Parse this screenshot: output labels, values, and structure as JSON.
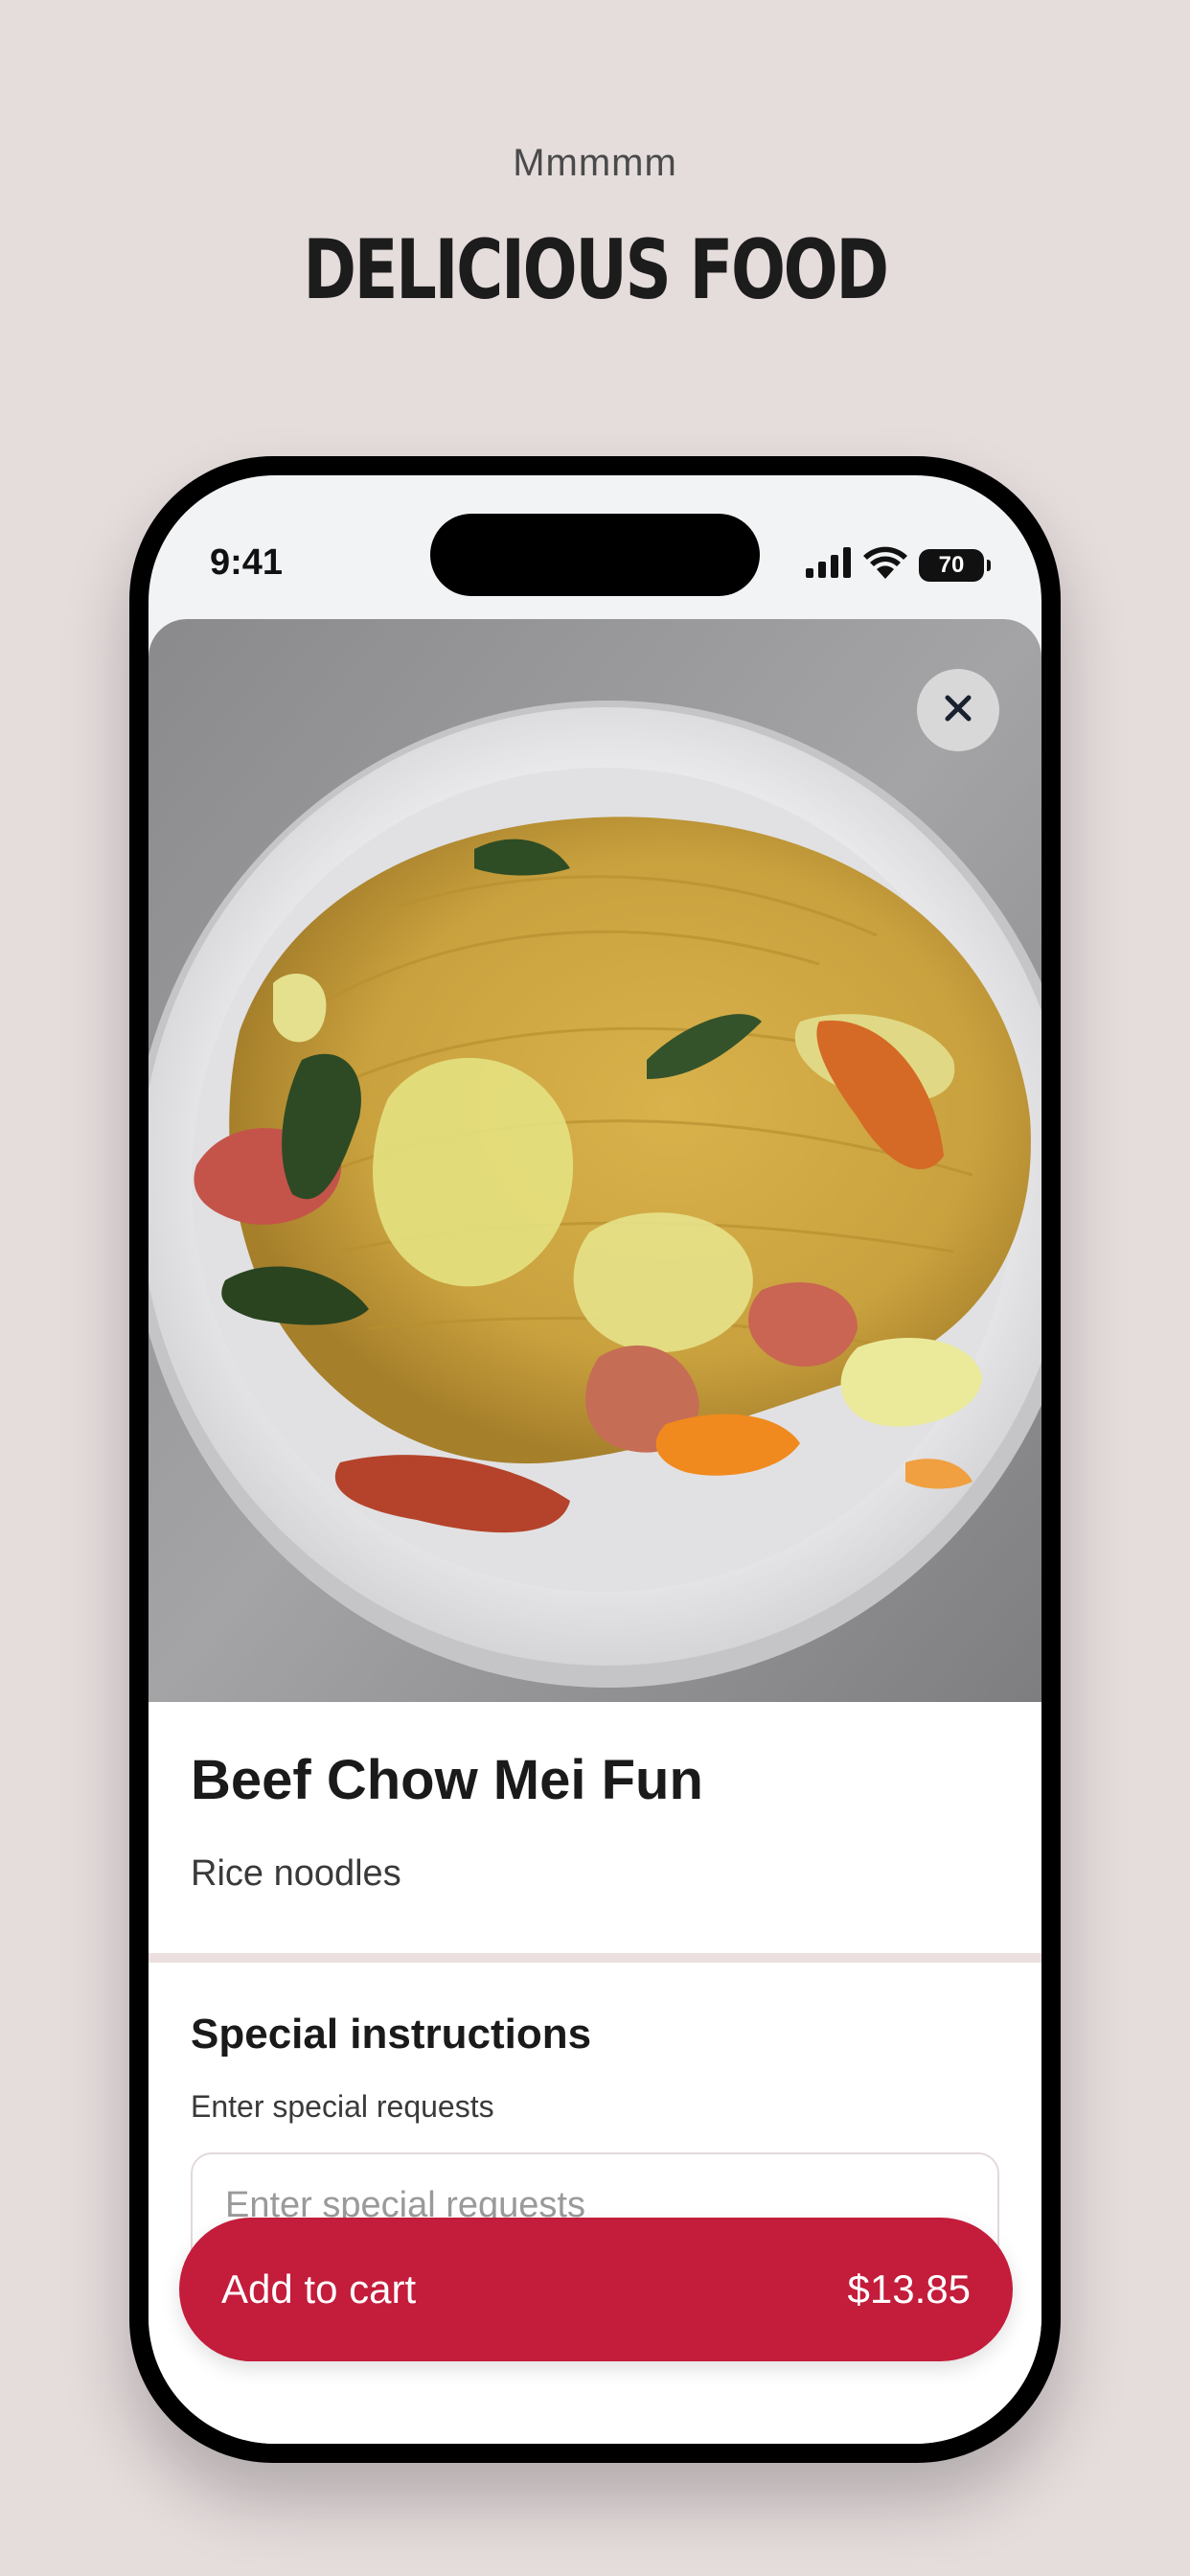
{
  "promo": {
    "subtitle": "Mmmmm",
    "title": "DELICIOUS FOOD"
  },
  "status_bar": {
    "time": "9:41",
    "battery": "70",
    "icons": [
      "signal-icon",
      "wifi-icon",
      "battery-icon"
    ]
  },
  "item": {
    "image": "noodle-dish-photo",
    "name": "Beef Chow Mei Fun",
    "description": "Rice noodles"
  },
  "special_instructions": {
    "title": "Special instructions",
    "subtitle": "Enter special requests",
    "placeholder": "Enter special requests",
    "value": ""
  },
  "cart": {
    "label": "Add to cart",
    "price": "$13.85"
  },
  "colors": {
    "accent": "#c41c3b",
    "background": "#e5dcdc"
  }
}
